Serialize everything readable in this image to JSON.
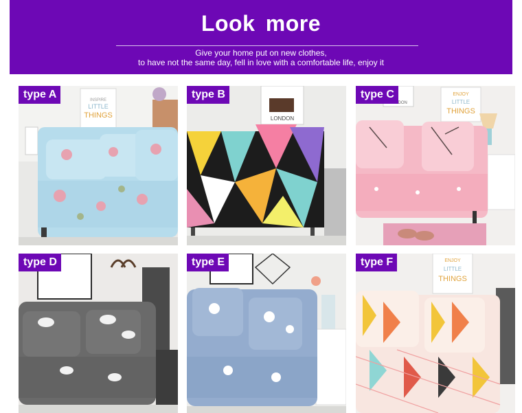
{
  "banner": {
    "title": "Look  more",
    "subtitle_line1": "Give your home put on new clothes,",
    "subtitle_line2": "to have not the same day, fell in love with a comfortable life, enjoy it",
    "color": "#6d08b5"
  },
  "tiles": [
    {
      "label": "type A",
      "poster_top": "INSPIRE",
      "poster_mid": "LITTLE",
      "poster_bottom": "THINGS"
    },
    {
      "label": "type B",
      "poster_bottom": "LONDON"
    },
    {
      "label": "type C",
      "poster_top": "ENJOY",
      "poster_mid": "LITTLE",
      "poster_bottom": "THINGS",
      "frame_text": "LONDON"
    },
    {
      "label": "type D"
    },
    {
      "label": "type E"
    },
    {
      "label": "type F",
      "poster_top": "ENJOY",
      "poster_mid": "LITTLE",
      "poster_bottom": "THINGS"
    }
  ]
}
